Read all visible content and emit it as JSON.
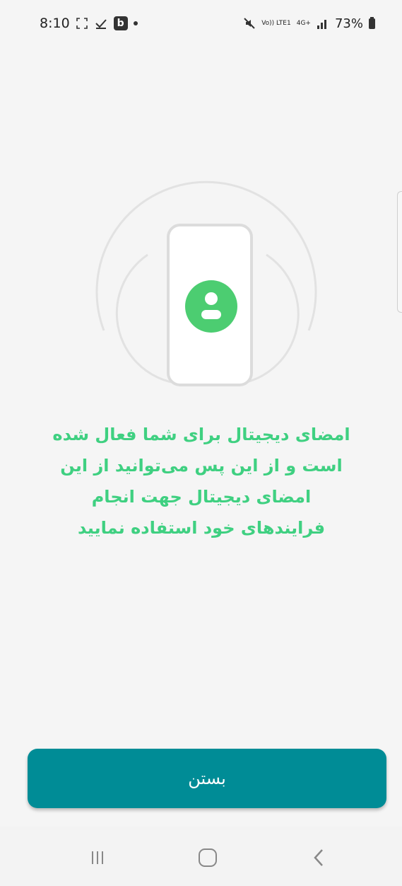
{
  "status_bar": {
    "time": "8:10",
    "network_top": "Vo)) LTE1",
    "network_type": "4G+",
    "battery": "73%",
    "icons": [
      "screenshot-icon",
      "download-done-icon",
      "b-app-icon",
      "dot-icon",
      "mute-icon",
      "signal-icon",
      "battery-icon"
    ]
  },
  "illustration": {
    "icon": "user-avatar-icon",
    "accent_color": "#4ccd71"
  },
  "message": "امضای دیجیتال برای شما فعال شده است و از این پس می‌توانید از این امضای دیجیتال جهت انجام فرایندهای خود استفاده نمایید",
  "close_button": {
    "label": "بستن",
    "color": "#008c96"
  },
  "navigation": {
    "recent": "recent-apps-icon",
    "home": "home-icon",
    "back": "back-icon"
  }
}
